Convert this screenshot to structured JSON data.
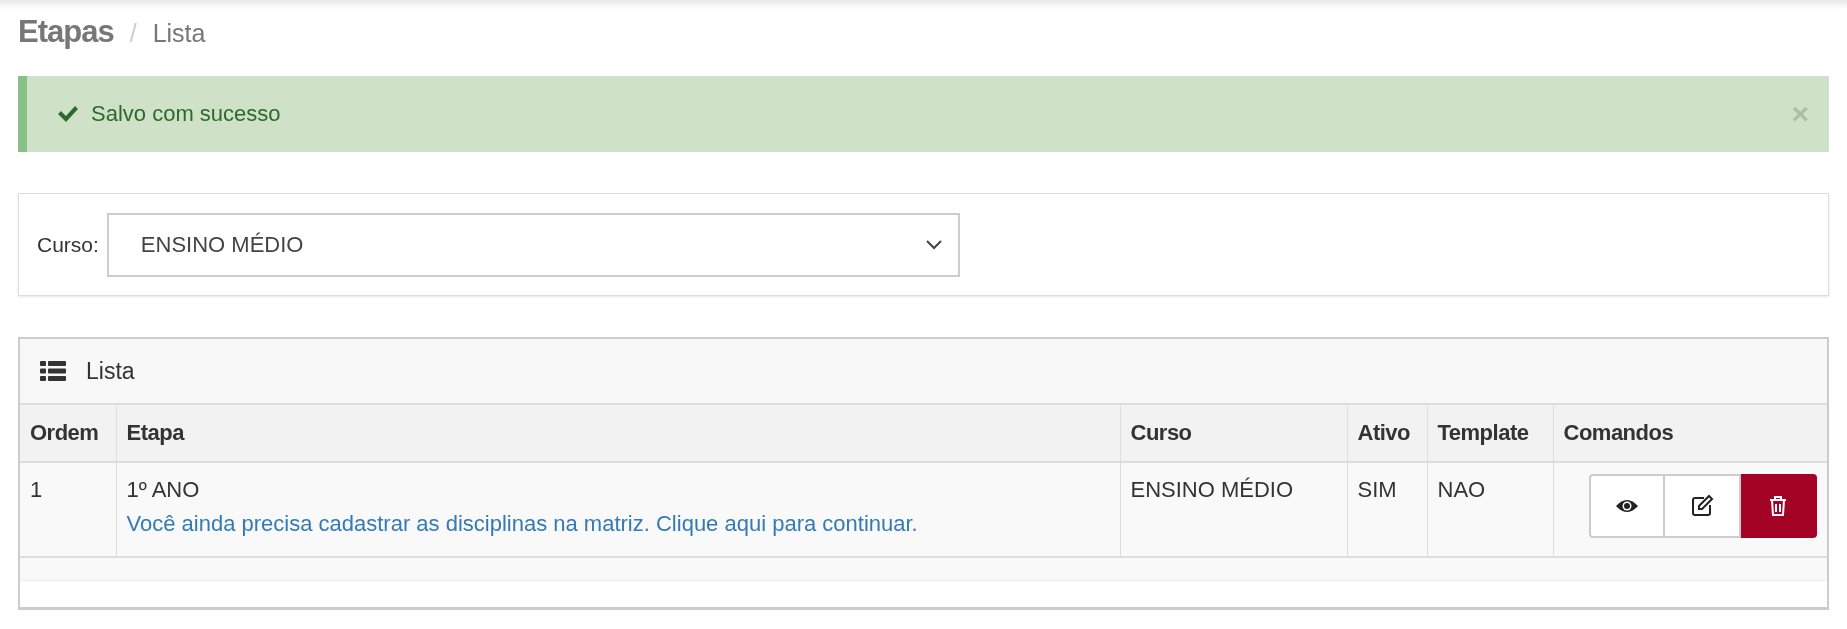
{
  "breadcrumb": {
    "title": "Etapas",
    "separator": "/",
    "current": "Lista"
  },
  "alert": {
    "message": "Salvo com sucesso",
    "close": "×"
  },
  "filter": {
    "label": "Curso:",
    "value": "ENSINO MÉDIO"
  },
  "panel": {
    "title": "Lista"
  },
  "table": {
    "columns": [
      "Ordem",
      "Etapa",
      "Curso",
      "Ativo",
      "Template",
      "Comandos"
    ],
    "rows": [
      {
        "ordem": "1",
        "etapa": "1º ANO",
        "link": "Você ainda precisa cadastrar as disciplinas na matriz. Clique aqui para continuar.",
        "curso": "ENSINO MÉDIO",
        "ativo": "SIM",
        "template": "NAO",
        "commands": [
          {
            "kind": "view"
          },
          {
            "kind": "edit"
          },
          {
            "kind": "delete"
          }
        ]
      }
    ]
  }
}
